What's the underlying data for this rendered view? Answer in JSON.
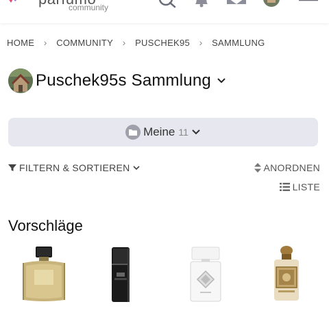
{
  "header": {
    "brand": "parfumo",
    "brand_sub": "community",
    "icons": [
      "logo-icon",
      "search-icon",
      "bell-icon",
      "mail-icon",
      "avatar-icon",
      "menu-icon"
    ],
    "accent_colors": [
      "#e8467c",
      "#7b4bd6",
      "#3aa6e8"
    ]
  },
  "breadcrumb": {
    "items": [
      "HOME",
      "COMMUNITY",
      "PUSCHEK95",
      "SAMMLUNG"
    ]
  },
  "title": {
    "text": "Puschek95s Sammlung"
  },
  "collection_select": {
    "label": "Meine",
    "count": "11"
  },
  "filter": {
    "label": "FILTERN & SORTIEREN",
    "arrange": "ANORDNEN",
    "list": "LISTE"
  },
  "suggestions": {
    "title": "Vorschläge",
    "items": [
      {
        "name": "perfume-amouage"
      },
      {
        "name": "perfume-black-bottle"
      },
      {
        "name": "perfume-initio"
      },
      {
        "name": "perfume-ornate"
      }
    ]
  }
}
